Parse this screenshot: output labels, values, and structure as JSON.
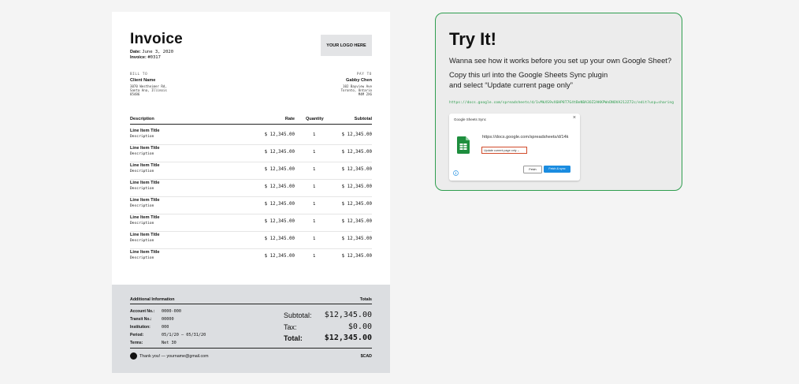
{
  "invoice": {
    "title": "Invoice",
    "date_label": "Date:",
    "date_value": "June 3, 2020",
    "number_label": "Invoice:",
    "number_value": "#0317",
    "logo": "YOUR LOGO HERE",
    "bill_to": {
      "label": "BILL TO",
      "name": "Client Name",
      "address": [
        "3070 Westheimer Rd,",
        "Santa Ana, Illinois",
        "85486"
      ]
    },
    "pay_to": {
      "label": "PAY TO",
      "name": "Gabby Chen",
      "address": [
        "102 Bayview Ave",
        "Toronto, Ontario",
        "M4M 2X6"
      ]
    },
    "columns": [
      "Description",
      "Rate",
      "Quantity",
      "Subtotal"
    ],
    "items": [
      {
        "title": "Line Item Title",
        "desc": "Description",
        "rate": "$ 12,345.00",
        "qty": "1",
        "subtotal": "$ 12,345.00"
      },
      {
        "title": "Line Item Title",
        "desc": "Description",
        "rate": "$ 12,345.00",
        "qty": "1",
        "subtotal": "$ 12,345.00"
      },
      {
        "title": "Line Item Title",
        "desc": "Description",
        "rate": "$ 12,345.00",
        "qty": "1",
        "subtotal": "$ 12,345.00"
      },
      {
        "title": "Line Item Title",
        "desc": "Description",
        "rate": "$ 12,345.00",
        "qty": "1",
        "subtotal": "$ 12,345.00"
      },
      {
        "title": "Line Item Title",
        "desc": "Description",
        "rate": "$ 12,345.00",
        "qty": "1",
        "subtotal": "$ 12,345.00"
      },
      {
        "title": "Line Item Title",
        "desc": "Description",
        "rate": "$ 12,345.00",
        "qty": "1",
        "subtotal": "$ 12,345.00"
      },
      {
        "title": "Line Item Title",
        "desc": "Description",
        "rate": "$ 12,345.00",
        "qty": "1",
        "subtotal": "$ 12,345.00"
      },
      {
        "title": "Line Item Title",
        "desc": "Description",
        "rate": "$ 12,345.00",
        "qty": "1",
        "subtotal": "$ 12,345.00"
      }
    ],
    "footer": {
      "additional_label": "Additional Information",
      "totals_label": "Totals",
      "fields": [
        {
          "label": "Account No.:",
          "value": "0000-000"
        },
        {
          "label": "Transit No.:",
          "value": "00000"
        },
        {
          "label": "Institution:",
          "value": "000"
        },
        {
          "label": "Period:",
          "value": "05/1/20 – 05/31/20"
        },
        {
          "label": "Terms:",
          "value": "Net 30"
        }
      ],
      "subtotal_label": "Subtotal:",
      "subtotal_value": "$12,345.00",
      "tax_label": "Tax:",
      "tax_value": "$0.00",
      "total_label": "Total:",
      "total_value": "$12,345.00",
      "thanks": "Thank you! — yourname@gmail.com",
      "currency": "$CAD"
    }
  },
  "try_it": {
    "title": "Try It!",
    "line1": "Wanna see how it works before you set up your own Google Sheet?",
    "line2": "Copy this url into the Google Sheets Sync plugin",
    "line3": "and select “Update current page only”",
    "url": "https://docs.google.com/spreadsheets/d/1vMkXS9vX6HP8T7G4tBeNBA3OZ2AKKPWnDNOVA212Z72c/edit?usp=sharing",
    "dialog": {
      "title": "Google Sheets Sync",
      "close": "×",
      "url_text": "https://docs.google.com/spreadsheets/d/14k",
      "select_value": "Update current page only ⌄",
      "cancel": "Fetch",
      "primary": "Fetch & sync"
    },
    "colors": {
      "border": "#2f9e4f",
      "primary_button": "#1a8ce0",
      "sheet_icon": "#1e8e3e"
    }
  }
}
